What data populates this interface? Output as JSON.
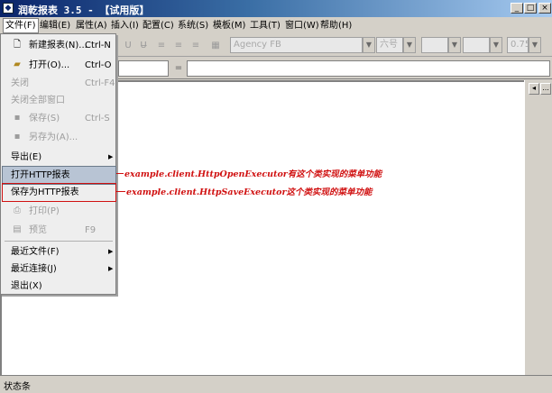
{
  "window": {
    "title": "润乾报表 3.5 - 【试用版】",
    "controls": [
      "_",
      "□",
      "×"
    ]
  },
  "menubar": [
    "文件(F)",
    "编辑(E)",
    "属性(A)",
    "插入(I)",
    "配置(C)",
    "系统(S)",
    "模板(M)",
    "工具(T)",
    "窗口(W)",
    "帮助(H)"
  ],
  "toolbar": {
    "font_name": "Agency FB",
    "font_size": "六号",
    "line_width": "0.75",
    "equals": "="
  },
  "file_menu": [
    {
      "label": "新建报表(N)...",
      "shortcut": "Ctrl-N",
      "icon": "new-document-icon",
      "enabled": true
    },
    {
      "label": "打开(O)...",
      "shortcut": "Ctrl-O",
      "icon": "open-folder-icon",
      "enabled": true
    },
    {
      "label": "关闭",
      "shortcut": "Ctrl-F4",
      "enabled": false
    },
    {
      "label": "关闭全部窗口",
      "shortcut": "",
      "enabled": false
    },
    {
      "label": "保存(S)",
      "shortcut": "Ctrl-S",
      "icon": "save-icon",
      "enabled": false
    },
    {
      "label": "另存为(A)...",
      "shortcut": "",
      "icon": "save-as-icon",
      "enabled": false
    },
    {
      "label": "导出(E)",
      "shortcut": "",
      "submenu": true,
      "enabled": true
    },
    {
      "label": "打开HTTP报表",
      "shortcut": "",
      "enabled": true,
      "highlight": true
    },
    {
      "label": "保存为HTTP报表",
      "shortcut": "",
      "enabled": true
    },
    {
      "label": "打印(P)",
      "shortcut": "",
      "icon": "print-icon",
      "enabled": false
    },
    {
      "label": "预览",
      "shortcut": "F9",
      "icon": "preview-icon",
      "enabled": false
    },
    {
      "label": "最近文件(F)",
      "shortcut": "",
      "submenu": true,
      "enabled": true
    },
    {
      "label": "最近连接(J)",
      "shortcut": "",
      "submenu": true,
      "enabled": true
    },
    {
      "label": "退出(X)",
      "shortcut": "",
      "enabled": true
    }
  ],
  "annotations": [
    "example.client.HttpOpenExecutor有这个类实现的菜单功能",
    "example.client.HttpSaveExecutor这个类实现的菜单功能"
  ],
  "scroll_buttons": [
    "◂",
    "..."
  ],
  "status": "状态条",
  "colors": {
    "title_start": "#0a246a",
    "title_end": "#a6caf0",
    "annotation": "#d01010",
    "highlight": "#b8c4d4"
  }
}
